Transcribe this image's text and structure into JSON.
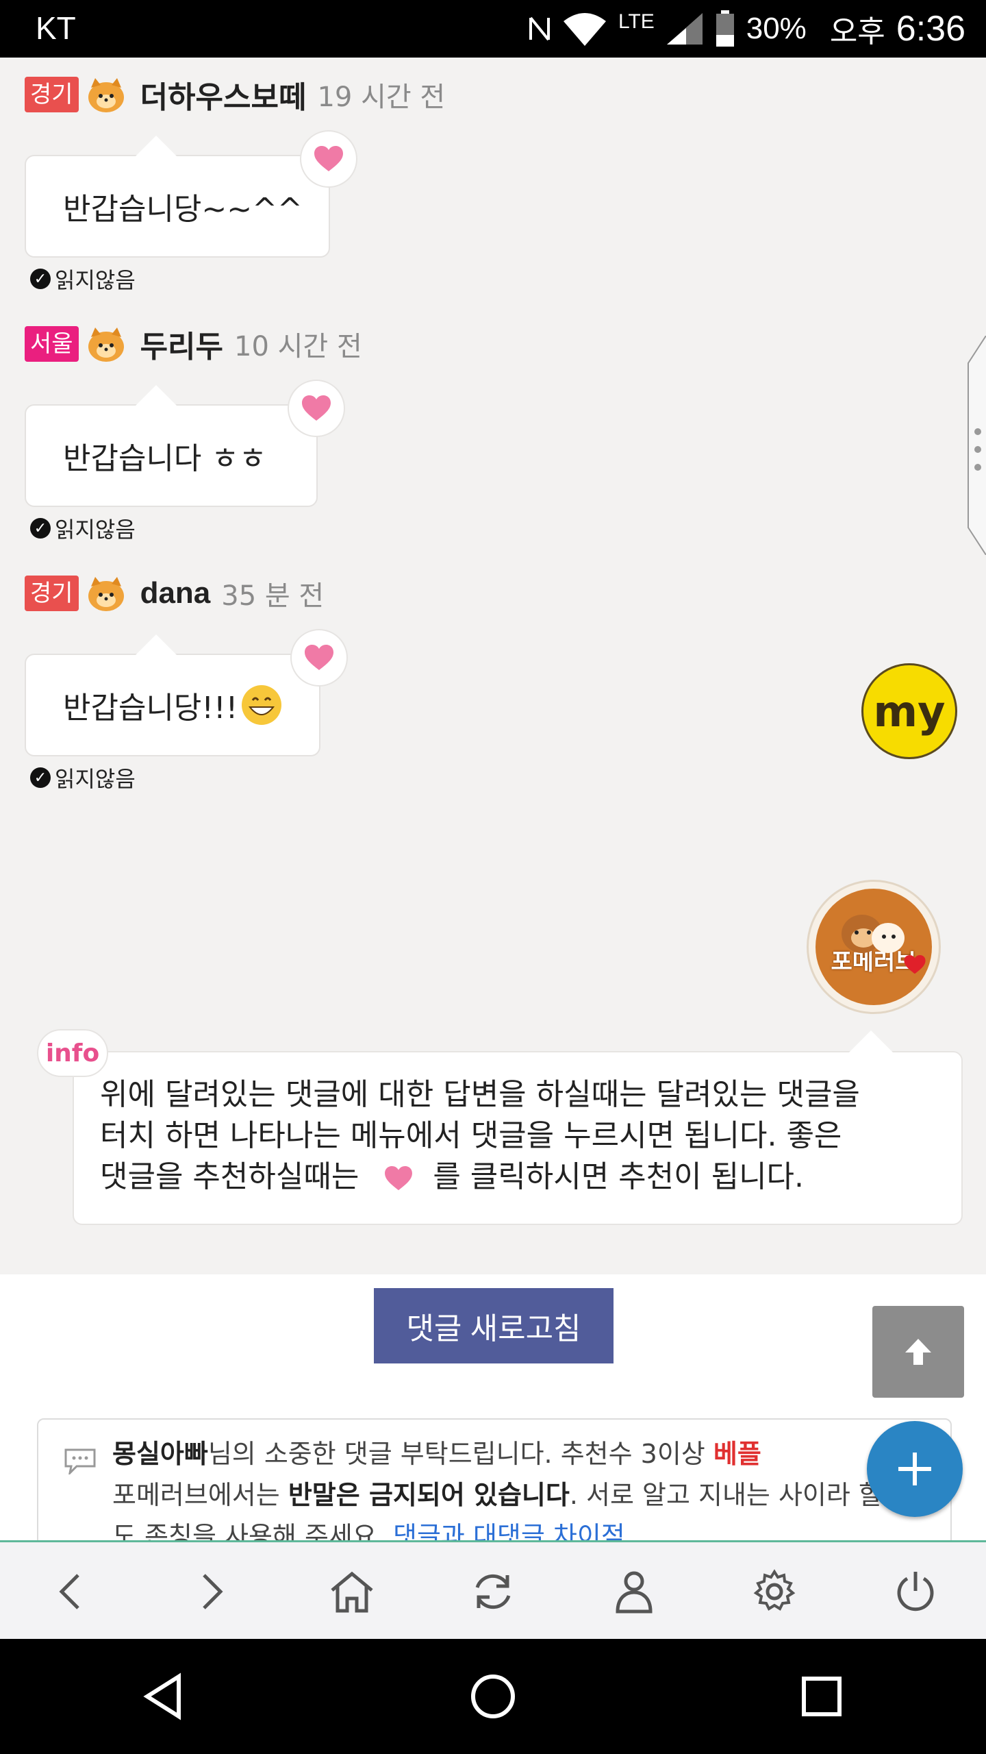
{
  "status_bar": {
    "carrier": "KT",
    "network": "LTE",
    "battery": "30%",
    "ampm": "오후",
    "time": "6:36"
  },
  "comments": [
    {
      "region": "경기",
      "region_color": "#e9504e",
      "username": "더하우스보떼",
      "ago": "19 시간 전",
      "text": "반갑습니당~~^^",
      "read_label": "읽지않음"
    },
    {
      "region": "서울",
      "region_color": "#ea1f7f",
      "username": "두리두",
      "ago": "10 시간 전",
      "text": "반갑습니다 ㅎㅎ",
      "read_label": "읽지않음"
    },
    {
      "region": "경기",
      "region_color": "#e9504e",
      "username": "dana",
      "ago": "35 분 전",
      "text": "반갑습니당!!!",
      "read_label": "읽지않음"
    }
  ],
  "my_button": "my",
  "logo": {
    "text": "포메러브"
  },
  "info": {
    "tag": "info",
    "line1": "위에 달려있는 댓글에 대한 답변을 하실때는 달려있는 댓글을",
    "line2": "터치 하면 나타나는 메뉴에서 댓글을 누르시면 됩니다. 좋은",
    "line3_a": "댓글을 추천하실때는",
    "line3_b": "를 클릭하시면 추천이 됩니다."
  },
  "refresh_button": "댓글 새로고침",
  "notice": {
    "name": "몽실아빠",
    "t1": "님의 소중한 댓글 부탁드립니다. 추천수 3이상",
    "best": "베플",
    "t2": "포메러브에서는",
    "bold": "반말은 금지되어 있습니다",
    "t3": ". 서로 알고 지내는 사이라 할지",
    "t4": "도 존칭을 사용해 주세요.",
    "link": "댓글과 대댓글 차이점"
  },
  "colors": {
    "heart": "#f07aa6",
    "accent_blue": "#2a85c4",
    "refresh_bg": "#515c9a",
    "my_yellow": "#f7dc00"
  }
}
